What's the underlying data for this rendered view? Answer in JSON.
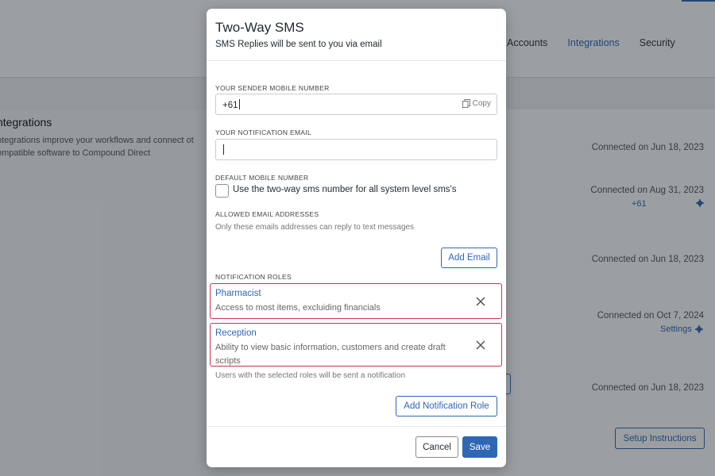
{
  "background": {
    "nav": [
      "Accounts",
      "Integrations",
      "Security"
    ],
    "nav_active": "Integrations",
    "section_title": "ntegrations",
    "section_desc_line1": "ntegrations improve your workflows and connect ot",
    "section_desc_line2": "ompatible software to Compound Direct",
    "connections": [
      "Connected on Jun 18, 2023",
      "Connected on Aug 31, 2023",
      "Connected on Jun 18, 2023",
      "Connected on Oct 7, 2024",
      "Connected on Jun 18, 2023"
    ],
    "phone_value": "+61",
    "settings_label": "Settings",
    "setup_instructions": "Setup Instructions"
  },
  "modal": {
    "title": "Two-Way SMS",
    "subtitle": "SMS Replies will be sent to you via email",
    "sender_label": "YOUR SENDER MOBILE NUMBER",
    "sender_value": "+61",
    "copy_label": "Copy",
    "notification_email_label": "YOUR NOTIFICATION EMAIL",
    "notification_email_value": "",
    "default_mobile_label": "DEFAULT MOBILE NUMBER",
    "default_mobile_checkbox": "Use the two-way sms number for all system level sms's",
    "default_mobile_checked": false,
    "allowed_emails_label": "ALLOWED EMAIL ADDRESSES",
    "allowed_emails_help": "Only these emails addresses can reply to text messages",
    "add_email": "Add Email",
    "notification_roles_label": "NOTIFICATION ROLES",
    "roles": [
      {
        "name": "Pharmacist",
        "desc_line1": "Access to most items, excluiding financials",
        "desc_line2": ""
      },
      {
        "name": "Reception",
        "desc_line1": "Ability to view basic information, customers and create draft",
        "desc_line2": "scripts"
      }
    ],
    "roles_help": "Users with the selected roles will be sent a notification",
    "add_role": "Add Notification Role",
    "cancel": "Cancel",
    "save": "Save",
    "accent_color": "#2f67b4",
    "highlight_color": "#d0304a"
  }
}
